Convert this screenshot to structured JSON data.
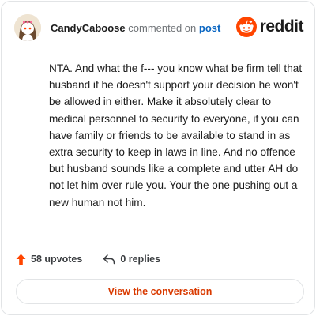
{
  "comment": {
    "author": "CandyCaboose",
    "action": "commented on",
    "target_link": "post",
    "text": "NTA. And what the f--- you know what be firm tell that husband if he doesn't support your decision he won't be allowed in either. Make it absolutely clear to medical personnel to security to everyone, if you can have family or friends to be available to stand in as extra security to keep in laws in line. And no offence but husband sounds like a complete and utter AH do not let him over rule you. Your the one pushing out a new human not him."
  },
  "brand": {
    "name": "reddit",
    "color": "#ff4500"
  },
  "stats": {
    "upvotes": "58 upvotes",
    "replies": "0 replies"
  },
  "cta": {
    "label": "View the conversation"
  },
  "icons": {
    "avatar": "snoo-avatar",
    "logo": "reddit-logo-icon",
    "upvote": "upvote-arrow-icon",
    "reply": "reply-arrow-icon"
  },
  "colors": {
    "upvote_accent": "#ff4500",
    "link": "#0a66c2",
    "cta_text": "#d93a00"
  }
}
